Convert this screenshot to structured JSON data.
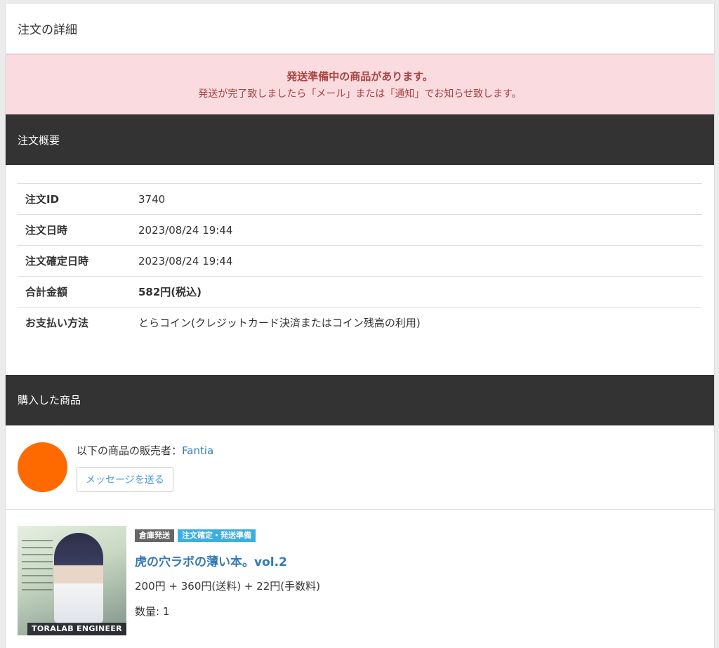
{
  "panel": {
    "title": "注文の詳細"
  },
  "alert": {
    "title": "発送準備中の商品があります。",
    "body": "発送が完了致しましたら「メール」または「通知」でお知らせ致します。"
  },
  "summary": {
    "heading": "注文概要",
    "rows": [
      {
        "label": "注文ID",
        "value": "3740"
      },
      {
        "label": "注文日時",
        "value": "2023/08/24 19:44"
      },
      {
        "label": "注文確定日時",
        "value": "2023/08/24 19:44"
      },
      {
        "label": "合計金額",
        "value": "582円(税込)"
      },
      {
        "label": "お支払い方法",
        "value": "とらコイン(クレジットカード決済またはコイン残高の利用)"
      }
    ]
  },
  "purchased": {
    "heading": "購入した商品",
    "seller_prefix": "以下の商品の販売者：",
    "seller_name": "Fantia",
    "message_button": "メッセージを送る",
    "avatar_color": "#ff6a00"
  },
  "product": {
    "cover_text": "TORALAB ENGINEER",
    "badges": [
      "倉庫発送",
      "注文確定・発送準備"
    ],
    "name": "虎の穴ラボの薄い本。vol.2",
    "price": "200円 + 360円(送料) + 22円(手数料)",
    "quantity": "数量: 1"
  },
  "colors": {
    "alert_bg": "#fadce0",
    "alert_text": "#a94442",
    "link": "#337ab7",
    "section_bg": "#333333"
  }
}
